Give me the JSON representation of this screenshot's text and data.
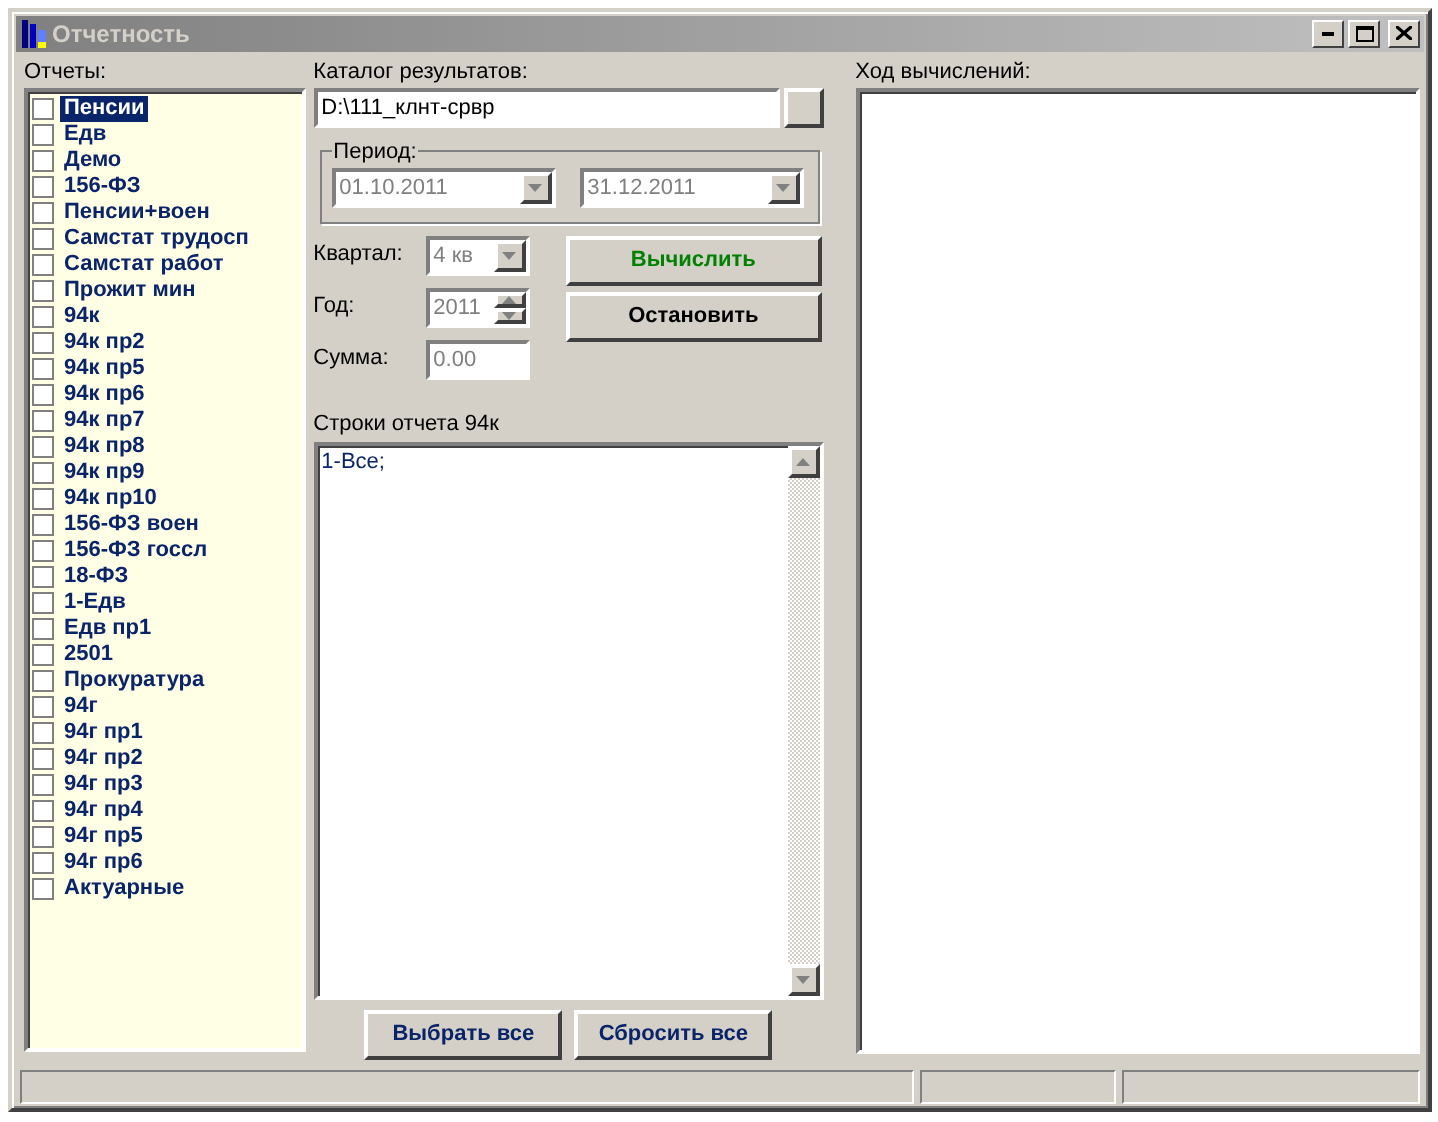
{
  "window": {
    "title": "Отчетность"
  },
  "reports": {
    "label": "Отчеты:",
    "items": [
      {
        "label": "Пенсии",
        "checked": false,
        "selected": true
      },
      {
        "label": "Едв",
        "checked": false,
        "selected": false
      },
      {
        "label": "Демо",
        "checked": false,
        "selected": false
      },
      {
        "label": "156-ФЗ",
        "checked": false,
        "selected": false
      },
      {
        "label": "Пенсии+воен",
        "checked": false,
        "selected": false
      },
      {
        "label": "Самстат трудосп",
        "checked": false,
        "selected": false
      },
      {
        "label": "Самстат работ",
        "checked": false,
        "selected": false
      },
      {
        "label": "Прожит мин",
        "checked": false,
        "selected": false
      },
      {
        "label": "94к",
        "checked": false,
        "selected": false
      },
      {
        "label": "94к пр2",
        "checked": false,
        "selected": false
      },
      {
        "label": "94к пр5",
        "checked": false,
        "selected": false
      },
      {
        "label": "94к пр6",
        "checked": false,
        "selected": false
      },
      {
        "label": "94к пр7",
        "checked": false,
        "selected": false
      },
      {
        "label": "94к пр8",
        "checked": false,
        "selected": false
      },
      {
        "label": "94к пр9",
        "checked": false,
        "selected": false
      },
      {
        "label": "94к пр10",
        "checked": false,
        "selected": false
      },
      {
        "label": "156-ФЗ воен",
        "checked": false,
        "selected": false
      },
      {
        "label": "156-ФЗ госсл",
        "checked": false,
        "selected": false
      },
      {
        "label": "18-ФЗ",
        "checked": false,
        "selected": false
      },
      {
        "label": "1-Едв",
        "checked": false,
        "selected": false
      },
      {
        "label": "Едв пр1",
        "checked": false,
        "selected": false
      },
      {
        "label": "2501",
        "checked": false,
        "selected": false
      },
      {
        "label": "Прокуратура",
        "checked": false,
        "selected": false
      },
      {
        "label": "94г",
        "checked": false,
        "selected": false
      },
      {
        "label": "94г пр1",
        "checked": false,
        "selected": false
      },
      {
        "label": "94г пр2",
        "checked": false,
        "selected": false
      },
      {
        "label": "94г пр3",
        "checked": false,
        "selected": false
      },
      {
        "label": "94г пр4",
        "checked": false,
        "selected": false
      },
      {
        "label": "94г пр5",
        "checked": false,
        "selected": false
      },
      {
        "label": "94г пр6",
        "checked": false,
        "selected": false
      },
      {
        "label": "Актуарные",
        "checked": false,
        "selected": false
      }
    ]
  },
  "output_dir": {
    "label": "Каталог результатов:",
    "value": "D:\\111_клнт-срвр"
  },
  "period": {
    "label": "Период:",
    "from": {
      "value": "01.10.2011",
      "disabled": true
    },
    "to": {
      "value": "31.12.2011",
      "disabled": true
    }
  },
  "quarter": {
    "label": "Квартал:",
    "value": "4 кв",
    "disabled": true
  },
  "year": {
    "label": "Год:",
    "value": "2011",
    "disabled": true
  },
  "sum": {
    "label": "Сумма:",
    "value": "0.00",
    "disabled": true
  },
  "actions": [
    {
      "label": "Вычислить",
      "kind": "run"
    },
    {
      "label": "Остановить",
      "kind": "stop"
    }
  ],
  "report_lines": {
    "label": "Строки отчета 94к",
    "value": "1-Все;"
  },
  "list_buttons": [
    "Выбрать все",
    "Сбросить все"
  ],
  "log": {
    "label": "Ход вычислений:"
  }
}
